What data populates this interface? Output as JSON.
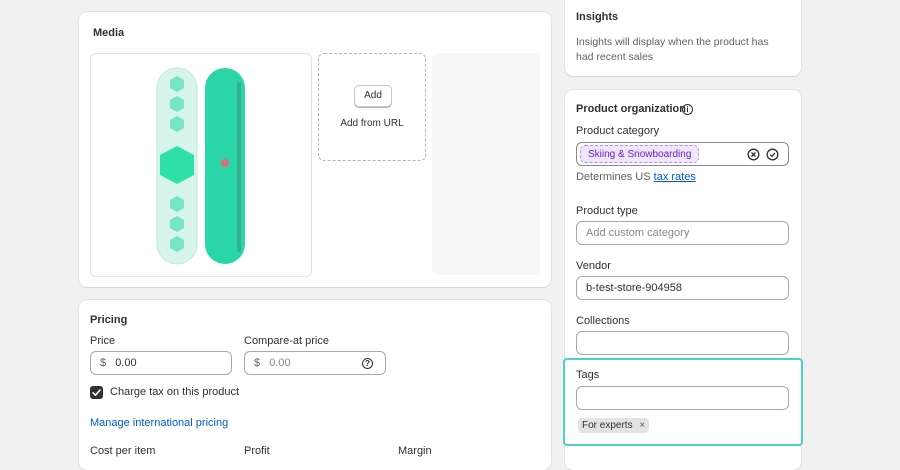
{
  "media": {
    "title": "Media",
    "add_button": "Add",
    "add_from_url": "Add from URL"
  },
  "pricing": {
    "title": "Pricing",
    "price_label": "Price",
    "price_prefix": "$",
    "price_value": "0.00",
    "compare_label": "Compare-at price",
    "compare_prefix": "$",
    "compare_placeholder": "0.00",
    "charge_tax_label": "Charge tax on this product",
    "charge_tax_checked": true,
    "manage_international": "Manage international pricing",
    "cost_per_item": "Cost per item",
    "profit": "Profit",
    "margin": "Margin"
  },
  "insights": {
    "title": "Insights",
    "text": "Insights will display when the product has had recent sales"
  },
  "organization": {
    "title": "Product organization",
    "category_label": "Product category",
    "category_chip": "Skiing & Snowboarding",
    "tax_text": "Determines US",
    "tax_link": "tax rates",
    "type_label": "Product type",
    "type_placeholder": "Add custom category",
    "vendor_label": "Vendor",
    "vendor_value": "b-test-store-904958",
    "collections_label": "Collections",
    "collections_value": "",
    "tags_label": "Tags",
    "tags_value": "",
    "tags": [
      "For experts"
    ]
  },
  "colors": {
    "link": "#005bd3",
    "highlight_border": "#4fd1c5",
    "chip_bg": "#f0e6ff",
    "chip_text": "#6a22c8",
    "board_teal": "#2ad6a8"
  }
}
